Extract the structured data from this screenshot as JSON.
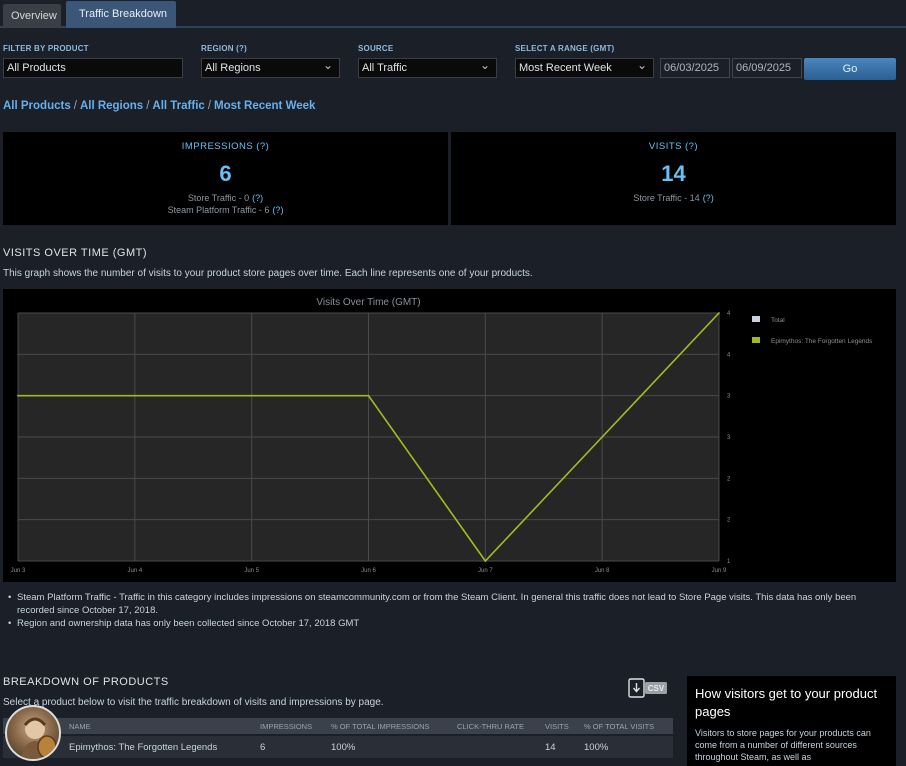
{
  "tabs": [
    {
      "label": "Overview",
      "active": false
    },
    {
      "label": "Traffic Breakdown",
      "active": true
    }
  ],
  "filters": {
    "product": {
      "label": "FILTER BY PRODUCT",
      "value": "All Products"
    },
    "region": {
      "label": "REGION (?)",
      "value": "All Regions"
    },
    "source": {
      "label": "SOURCE",
      "value": "All Traffic"
    },
    "range": {
      "label": "SELECT A RANGE (GMT)",
      "value": "Most Recent Week",
      "start": "06/03/2025",
      "end": "06/09/2025"
    },
    "go_label": "Go"
  },
  "breadcrumb": [
    "All Products",
    "All Regions",
    "All Traffic",
    "Most Recent Week"
  ],
  "impressions": {
    "title": "IMPRESSIONS",
    "help": "(?)",
    "value": "6",
    "store_line": "Store Traffic - 0",
    "platform_line": "Steam Platform Traffic - 6"
  },
  "visits": {
    "title": "VISITS",
    "help": "(?)",
    "value": "14",
    "store_line": "Store Traffic - 14"
  },
  "visits_section": {
    "title": "VISITS OVER TIME (GMT)",
    "description": "This graph shows the number of visits to your product store pages over time. Each line represents one of your products."
  },
  "chart_data": {
    "type": "line",
    "title": "Visits Over Time (GMT)",
    "categories": [
      "Jun 3",
      "Jun 4",
      "Jun 5",
      "Jun 6",
      "Jun 7",
      "Jun 8",
      "Jun 9"
    ],
    "y_tick_labels": [
      "1",
      "2",
      "2",
      "3",
      "3",
      "4",
      "4"
    ],
    "ylim": [
      1,
      4
    ],
    "grid": true,
    "legend_position": "right",
    "series": [
      {
        "name": "Total",
        "color": "#c9d2dc",
        "values": [
          3,
          3,
          3,
          3,
          1,
          2.5,
          4
        ]
      },
      {
        "name": "Epimythos: The Forgotten Legends",
        "color": "#a4b81e",
        "values": [
          3,
          3,
          3,
          3,
          1,
          2.5,
          4
        ]
      }
    ]
  },
  "notes": [
    "Steam Platform Traffic - Traffic in this category includes impressions on steamcommunity.com or from the Steam Client. In general this traffic does not lead to Store Page visits. This data has only been recorded since October 17, 2018.",
    "Region and ownership data has only been collected since October 17, 2018 GMT"
  ],
  "breakdown": {
    "title": "BREAKDOWN OF PRODUCTS",
    "description": "Select a product below to visit the traffic breakdown of visits and impressions by page.",
    "csv_label": "CSV",
    "columns": [
      "NAME",
      "IMPRESSIONS",
      "% OF TOTAL IMPRESSIONS",
      "CLICK-THRU RATE",
      "VISITS",
      "% OF TOTAL VISITS"
    ],
    "rows": [
      {
        "name": "Epimythos: The Forgotten Legends",
        "impressions": "6",
        "pct_impressions": "100%",
        "ctr": "",
        "visits": "14",
        "pct_visits": "100%"
      }
    ]
  },
  "sidebar": {
    "title": "How visitors get to your product pages",
    "body": "Visitors to store pages for your products can come from a number of different sources throughout Steam, as well as"
  }
}
